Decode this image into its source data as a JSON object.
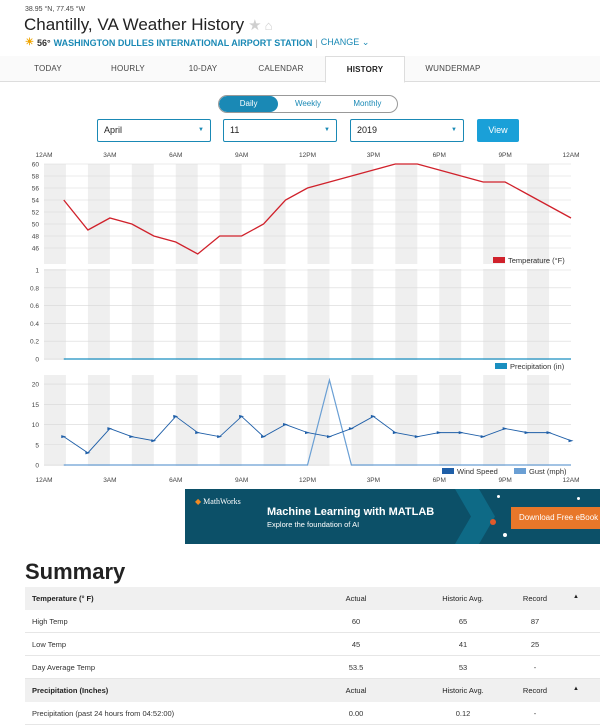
{
  "location": {
    "coords": "38.95 °N, 77.45 °W",
    "title": "Chantilly, VA Weather History",
    "current_temp": "56°",
    "station": "WASHINGTON DULLES INTERNATIONAL AIRPORT STATION",
    "separator": "|",
    "change_label": "CHANGE",
    "icons": [
      "star-icon",
      "home-icon",
      "sun-icon",
      "chevron-down-icon"
    ]
  },
  "tabs": [
    {
      "label": "TODAY",
      "active": false
    },
    {
      "label": "HOURLY",
      "active": false
    },
    {
      "label": "10-DAY",
      "active": false
    },
    {
      "label": "CALENDAR",
      "active": false
    },
    {
      "label": "HISTORY",
      "active": true
    },
    {
      "label": "WUNDERMAP",
      "active": false
    }
  ],
  "period_toggle": {
    "options": [
      "Daily",
      "Weekly",
      "Monthly"
    ],
    "selected": "Daily"
  },
  "date_selects": {
    "month": "April",
    "day": "11",
    "year": "2019",
    "view_label": "View"
  },
  "colors": {
    "accent": "#1a89b5",
    "temperature": "#d0212b",
    "precipitation": "#1a8fc0",
    "wind": "#1f5fa8",
    "gust": "#6a9fd4"
  },
  "chart_data": [
    {
      "type": "line",
      "x_ticks": [
        "12AM",
        "3AM",
        "6AM",
        "9AM",
        "12PM",
        "3PM",
        "6PM",
        "9PM",
        "12AM"
      ],
      "x_hours": [
        0.9,
        2,
        3,
        4,
        5,
        6,
        7,
        8,
        9,
        10,
        11,
        12,
        13,
        14,
        15,
        16,
        17,
        18,
        19,
        20,
        21,
        22,
        23,
        24
      ],
      "series": [
        {
          "name": "Temperature (°F)",
          "values": [
            54,
            49,
            51,
            50,
            48,
            47,
            45,
            48,
            48,
            50,
            54,
            56,
            57,
            58,
            59,
            60,
            60,
            59,
            58,
            57,
            57,
            55,
            53,
            51
          ]
        }
      ],
      "y_ticks": [
        "46",
        "48",
        "50",
        "52",
        "54",
        "56",
        "58",
        "60"
      ],
      "ylim": [
        46,
        60
      ],
      "legend_placement": "bottom-right",
      "grid": true
    },
    {
      "type": "line",
      "series": [
        {
          "name": "Precipitation (in)",
          "values": [
            0,
            0,
            0,
            0,
            0,
            0,
            0,
            0,
            0,
            0,
            0,
            0,
            0,
            0,
            0,
            0,
            0,
            0,
            0,
            0,
            0,
            0,
            0,
            0
          ]
        }
      ],
      "y_ticks": [
        "0",
        "0.2",
        "0.4",
        "0.6",
        "0.8",
        "1"
      ],
      "ylim": [
        0,
        1
      ],
      "legend_placement": "bottom-right",
      "grid": true
    },
    {
      "type": "line",
      "series": [
        {
          "name": "Wind Speed",
          "values": [
            7,
            3,
            9,
            7,
            6,
            12,
            8,
            7,
            12,
            7,
            10,
            8,
            7,
            9,
            12,
            8,
            7,
            8,
            8,
            7,
            9,
            8,
            8,
            6
          ]
        },
        {
          "name": "Gust (mph)",
          "values": [
            0,
            0,
            0,
            0,
            0,
            0,
            0,
            0,
            0,
            0,
            0,
            0,
            21,
            0,
            0,
            0,
            0,
            0,
            0,
            0,
            0,
            0,
            0,
            0
          ]
        }
      ],
      "x_ticks": [
        "12AM",
        "3AM",
        "6AM",
        "9AM",
        "12PM",
        "3PM",
        "6PM",
        "9PM",
        "12AM"
      ],
      "y_ticks": [
        "0",
        "5",
        "10",
        "15",
        "20"
      ],
      "ylim": [
        0,
        21
      ],
      "legend_placement": "bottom-right",
      "grid": true
    }
  ],
  "ad": {
    "brand": "MathWorks",
    "headline": "Machine Learning with MATLAB",
    "subline": "Explore the foundation of AI",
    "cta": "Download Free eBook"
  },
  "summary": {
    "title": "Summary",
    "sections": [
      {
        "header": {
          "label": "Temperature (° F)",
          "actual": "Actual",
          "historic": "Historic Avg.",
          "record": "Record"
        },
        "rows": [
          {
            "label": "High Temp",
            "actual": "60",
            "historic": "65",
            "record": "87"
          },
          {
            "label": "Low Temp",
            "actual": "45",
            "historic": "41",
            "record": "25"
          },
          {
            "label": "Day Average Temp",
            "actual": "53.5",
            "historic": "53",
            "record": "-"
          }
        ]
      },
      {
        "header": {
          "label": "Precipitation (Inches)",
          "actual": "Actual",
          "historic": "Historic Avg.",
          "record": "Record"
        },
        "rows": [
          {
            "label": "Precipitation (past 24 hours from 04:52:00)",
            "actual": "0.00",
            "historic": "0.12",
            "record": "-"
          }
        ]
      }
    ]
  }
}
